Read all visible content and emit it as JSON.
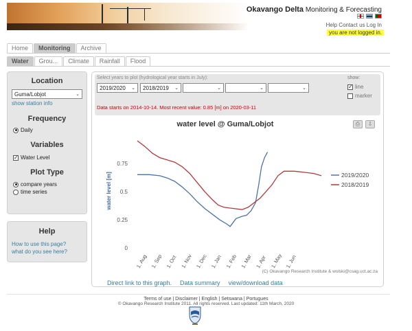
{
  "header": {
    "title_bold": "Okavango Delta",
    "title_rest": " Monitoring & Forecasting",
    "links": "Help Contact us Log In",
    "login_status": "you are not logged in."
  },
  "main_tabs": [
    {
      "label": "Home",
      "active": false
    },
    {
      "label": "Monitoring",
      "active": true
    },
    {
      "label": "Archive",
      "active": false
    }
  ],
  "sub_tabs": [
    {
      "label": "Water",
      "active": true
    },
    {
      "label": "Grou...",
      "active": false
    },
    {
      "label": "Climate",
      "active": false
    },
    {
      "label": "Rainfall",
      "active": false
    },
    {
      "label": "Flood",
      "active": false
    }
  ],
  "sidebar": {
    "location_title": "Location",
    "location_value": "Guma/Lobjot",
    "show_station_info": "show station info",
    "frequency_title": "Frequency",
    "frequency_option": "Daily",
    "variables_title": "Variables",
    "variable_option": "Water Level",
    "plot_type_title": "Plot Type",
    "plot_type_options": [
      "compare years",
      "time series"
    ]
  },
  "help": {
    "title": "Help",
    "link1": "How to use this page?",
    "link2": "what do you see here?"
  },
  "controls": {
    "hint": "Select years to plot (hydrological year starts in July):",
    "years": [
      "2019/2020",
      "2018/2019",
      "",
      "",
      ""
    ],
    "show_label": "show:",
    "show_line": "line",
    "show_marker": "marker",
    "info": "Data starts on 2014-10-14. Most recent value: 0.85 [m] on 2020-03-11"
  },
  "chart_data": {
    "type": "line",
    "title": "water level @ Guma/Lobjot",
    "ylabel": "water level [m]",
    "xlabel": "",
    "ylim": [
      0,
      0.95
    ],
    "yticks": [
      "0",
      "0.25",
      "0.5",
      "0.75"
    ],
    "xticks": [
      "1. Aug",
      "1. Sep",
      "1. Oct",
      "1. Nov",
      "1. Dec",
      "1. Jan",
      "1. Feb",
      "1. Mar",
      "1. Apr",
      "1. May",
      "1. Jun"
    ],
    "credit": "(C) Okavango Research Institute & wolski@csag.uct.ac.za",
    "legend_position": "right",
    "series": [
      {
        "name": "2019/2020",
        "color": "#4a72a8",
        "points": [
          [
            0,
            0.65
          ],
          [
            0.8,
            0.65
          ],
          [
            1.5,
            0.64
          ],
          [
            2.0,
            0.62
          ],
          [
            2.5,
            0.59
          ],
          [
            3.0,
            0.54
          ],
          [
            3.5,
            0.48
          ],
          [
            4.0,
            0.41
          ],
          [
            4.5,
            0.35
          ],
          [
            5.0,
            0.3
          ],
          [
            5.5,
            0.25
          ],
          [
            6.0,
            0.21
          ],
          [
            6.2,
            0.19
          ],
          [
            6.6,
            0.26
          ],
          [
            7.0,
            0.28
          ],
          [
            7.3,
            0.29
          ],
          [
            7.6,
            0.33
          ],
          [
            7.9,
            0.4
          ],
          [
            8.1,
            0.55
          ],
          [
            8.3,
            0.72
          ],
          [
            8.5,
            0.8
          ],
          [
            8.7,
            0.85
          ]
        ]
      },
      {
        "name": "2018/2019",
        "color": "#b03a3a",
        "points": [
          [
            0,
            0.95
          ],
          [
            0.5,
            0.9
          ],
          [
            1.0,
            0.84
          ],
          [
            1.5,
            0.8
          ],
          [
            2.0,
            0.78
          ],
          [
            2.5,
            0.76
          ],
          [
            3.0,
            0.72
          ],
          [
            3.5,
            0.66
          ],
          [
            4.0,
            0.58
          ],
          [
            4.5,
            0.5
          ],
          [
            5.0,
            0.43
          ],
          [
            5.4,
            0.38
          ],
          [
            5.8,
            0.36
          ],
          [
            6.4,
            0.35
          ],
          [
            7.0,
            0.34
          ],
          [
            7.4,
            0.36
          ],
          [
            7.8,
            0.4
          ],
          [
            8.2,
            0.44
          ],
          [
            8.6,
            0.5
          ],
          [
            9.0,
            0.56
          ],
          [
            9.4,
            0.64
          ],
          [
            9.8,
            0.68
          ],
          [
            10.5,
            0.68
          ],
          [
            11.2,
            0.67
          ],
          [
            11.8,
            0.66
          ],
          [
            12.3,
            0.64
          ]
        ]
      }
    ]
  },
  "bottom_links": [
    "Direct link to this graph.",
    "Data summary",
    "view/download data"
  ],
  "footer": {
    "links": "Terms of use   |   Disclaimer   |   English   |   Setswana   |   Portugues",
    "copyright": "© Okavango Research Institute 2011. All rights reserved. Last updated: 11th March, 2020"
  }
}
